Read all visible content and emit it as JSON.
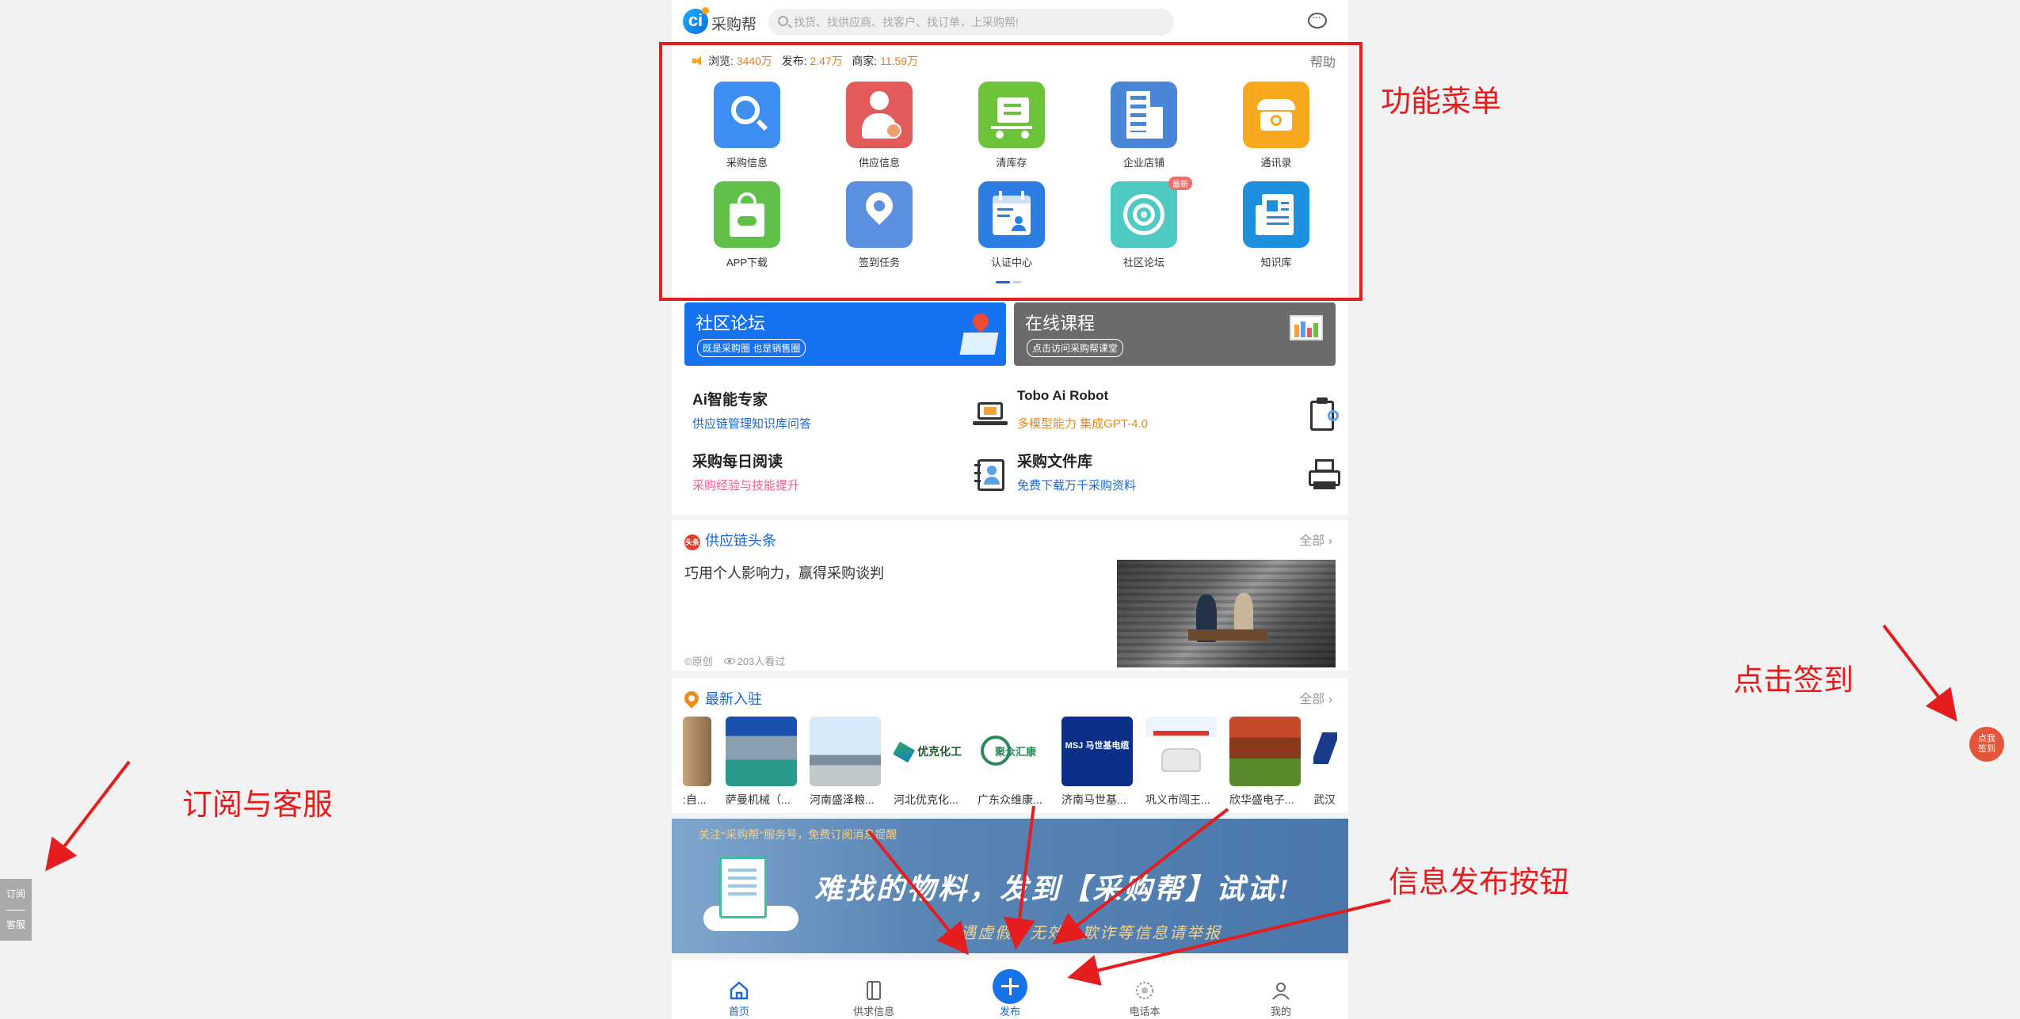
{
  "header": {
    "logo_letter": "ci",
    "logo_text": "采购帮",
    "search_placeholder": "找货、找供应商、找客户、找订单，上采购帮!"
  },
  "stats": {
    "browse_label": "浏览:",
    "browse_value": "3440万",
    "publish_label": "发布:",
    "publish_value": "2.47万",
    "merchant_label": "商家:",
    "merchant_value": "11.59万",
    "help": "帮助"
  },
  "menu": {
    "items": [
      {
        "label": "采购信息",
        "icon": "search-icon",
        "color": "#3d8ef0"
      },
      {
        "label": "供应信息",
        "icon": "supplier-icon",
        "color": "#e35a5a"
      },
      {
        "label": "清库存",
        "icon": "cart-icon",
        "color": "#6cc339"
      },
      {
        "label": "企业店铺",
        "icon": "building-icon",
        "color": "#4a86d6"
      },
      {
        "label": "通讯录",
        "icon": "phone-icon",
        "color": "#f7a81c"
      },
      {
        "label": "APP下载",
        "icon": "bag-icon",
        "color": "#5fc04a"
      },
      {
        "label": "签到任务",
        "icon": "location-icon",
        "color": "#5b8fe0"
      },
      {
        "label": "认证中心",
        "icon": "calendar-user-icon",
        "color": "#2b7de0"
      },
      {
        "label": "社区论坛",
        "icon": "target-icon",
        "color": "#4fc9c4",
        "badge": "最新"
      },
      {
        "label": "知识库",
        "icon": "newspaper-icon",
        "color": "#1f8fe0"
      }
    ],
    "active_page": 1,
    "page_count": 2
  },
  "banners": [
    {
      "title": "社区论坛",
      "subtitle": "既是采购圈 也是销售圈",
      "color": "#1572f0"
    },
    {
      "title": "在线课程",
      "subtitle": "点击访问采购帮课堂",
      "color": "#6b6b6b"
    }
  ],
  "ai": [
    {
      "title": "Ai智能专家",
      "subtitle": "供应链管理知识库问答",
      "sub_color": "#1a66d6"
    },
    {
      "title": "Tobo Ai Robot",
      "subtitle": "多模型能力 集成GPT-4.0",
      "sub_color": "#e8891a"
    },
    {
      "title": "采购每日阅读",
      "subtitle": "采购经验与技能提升",
      "sub_color": "#f0608a"
    },
    {
      "title": "采购文件库",
      "subtitle": "免费下载万千采购资料",
      "sub_color": "#1a66d6"
    }
  ],
  "news": {
    "section_badge": "头条",
    "section_title": "供应链头条",
    "more": "全部 ›",
    "title": "巧用个人影响力，赢得采购谈判",
    "original": "©原创",
    "views": "203人看过"
  },
  "settled": {
    "section_title": "最新入驻",
    "more": "全部 ›",
    "firms": [
      {
        "name": ":自..."
      },
      {
        "name": "萨曼机械（..."
      },
      {
        "name": "河南盛泽粮..."
      },
      {
        "name": "河北优克化...",
        "logo_text": "优克化工"
      },
      {
        "name": "广东众维康...",
        "logo_text": "聚众汇康"
      },
      {
        "name": "济南马世基...",
        "logo_text": "MSJ 马世基电缆"
      },
      {
        "name": "巩义市闯王..."
      },
      {
        "name": "欣华盛电子..."
      },
      {
        "name": "武汉"
      }
    ]
  },
  "ad": {
    "top": "关注“采购帮”服务号，免费订阅消息提醒",
    "main": "难找的物料，发到【采购帮】试试!",
    "sub": "*遇虚假、无效、欺诈等信息请举报"
  },
  "tabbar": [
    {
      "label": "首页",
      "icon": "home-icon",
      "active": true
    },
    {
      "label": "供求信息",
      "icon": "book-icon",
      "active": false
    },
    {
      "label": "发布",
      "icon": "plus-icon",
      "active": false
    },
    {
      "label": "电话本",
      "icon": "contacts-icon",
      "active": false
    },
    {
      "label": "我的",
      "icon": "user-icon",
      "active": false
    }
  ],
  "annotations": {
    "menu": "功能菜单",
    "sign": "点击签到",
    "subscribe": "订阅与客服",
    "publish": "信息发布按钮"
  },
  "floating": {
    "sign_line1": "点我",
    "sign_line2": "签到",
    "subscribe": "订阅",
    "service": "客服"
  }
}
